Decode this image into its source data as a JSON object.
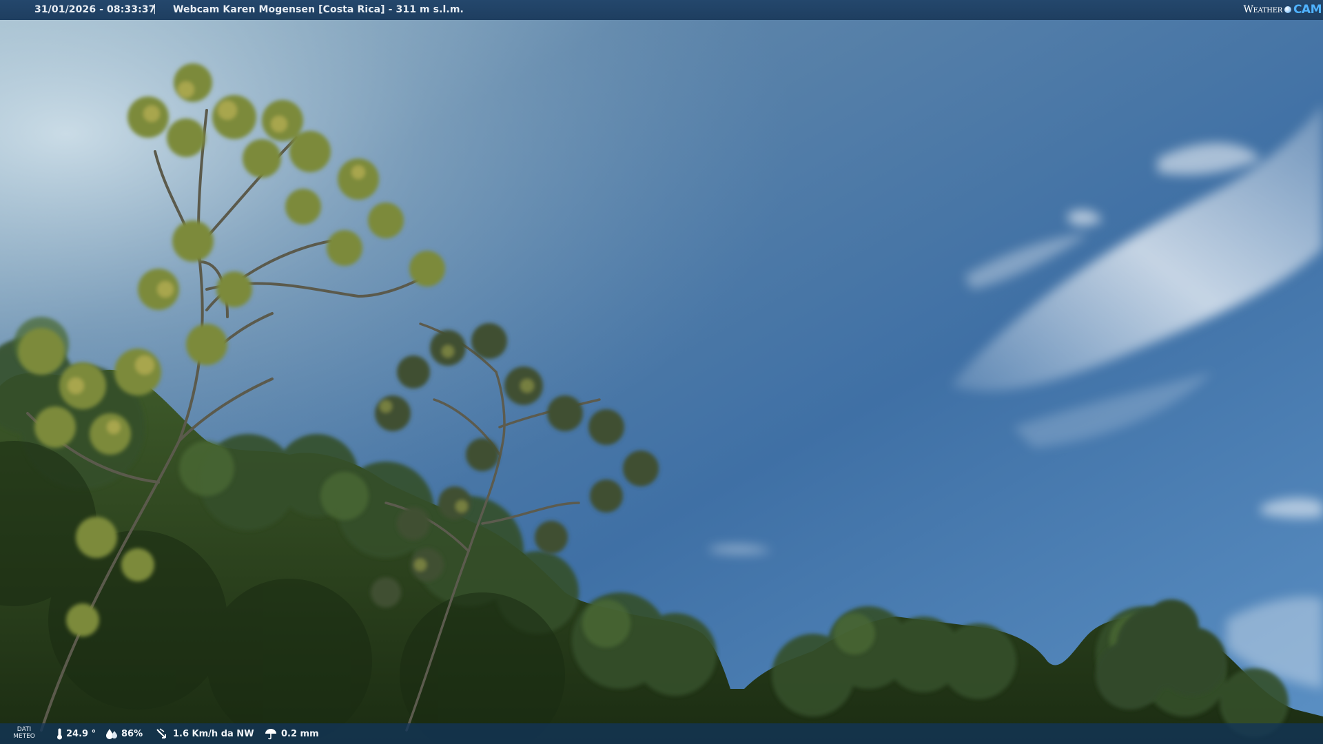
{
  "header": {
    "timestamp": "31/01/2026 - 08:33:37",
    "separator": "|",
    "webcam_title": "Webcam Karen Mogensen [Costa Rica] - 311 m s.l.m.",
    "logo_left": "Weather",
    "logo_right": "CAM"
  },
  "footer": {
    "label_line1": "DATI",
    "label_line2": "METEO",
    "temperature": "24.9 °",
    "humidity": "86%",
    "wind": "1.6 Km/h da NW",
    "rain": "0.2 mm"
  },
  "icons": {
    "temperature": "thermometer-icon",
    "humidity": "humidity-drop-icon",
    "wind": "wind-icon",
    "rain": "rain-umbrella-icon",
    "logo": "weathercam-logo-icon"
  },
  "colors": {
    "sky_top": "#3f6f9e",
    "sky_bottom": "#4f8ac2",
    "foliage": "#2f4a1e",
    "bar": "#1f4063"
  }
}
